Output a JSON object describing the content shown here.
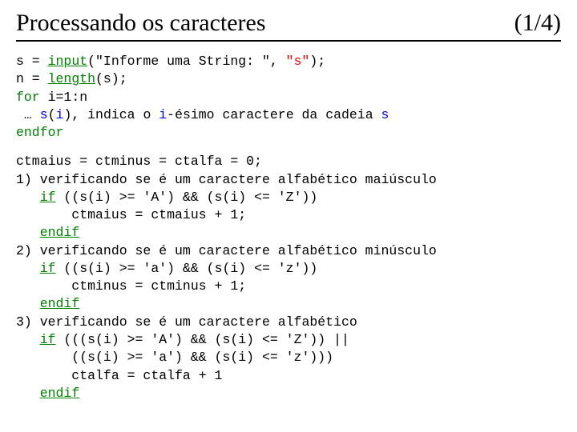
{
  "header": {
    "title": "Processando os caracteres",
    "pager": "(1/4)"
  },
  "c": {
    "l1a": "s = ",
    "l1b": "input",
    "l1c": "(\"Informe uma String: \", ",
    "l1d": "\"s\"",
    "l1e": ");",
    "l2a": "n = ",
    "l2b": "length",
    "l2c": "(s);",
    "l3a": "for",
    "l3b": " i=1:n",
    "l4a": " … ",
    "l4b": "s",
    "l4c": "(",
    "l4d": "i",
    "l4e": "), indica o ",
    "l4f": "i",
    "l4g": "-ésimo caractere da cadeia ",
    "l4h": "s",
    "l5a": "endfor",
    "l6": "ctmaius = ctminus = ctalfa = 0;",
    "l7": "1) verificando se é um caractere alfabético maiúsculo",
    "l8a": "   ",
    "l8b": "if",
    "l8c": " ((s(i) >= 'A') && (s(i) <= 'Z'))",
    "l9": "       ctmaius = ctmaius + 1;",
    "l10a": "   ",
    "l10b": "endif",
    "l11": "2) verificando se é um caractere alfabético minúsculo",
    "l12a": "   ",
    "l12b": "if",
    "l12c": " ((s(i) >= 'a') && (s(i) <= 'z'))",
    "l13": "       ctminus = ctminus + 1;",
    "l14a": "   ",
    "l14b": "endif",
    "l15": "3) verificando se é um caractere alfabético",
    "l16a": "   ",
    "l16b": "if",
    "l16c": " (((s(i) >= 'A') && (s(i) <= 'Z')) ||",
    "l17": "       ((s(i) >= 'a') && (s(i) <= 'z')))",
    "l18": "       ctalfa = ctalfa + 1",
    "l19a": "   ",
    "l19b": "endif"
  }
}
